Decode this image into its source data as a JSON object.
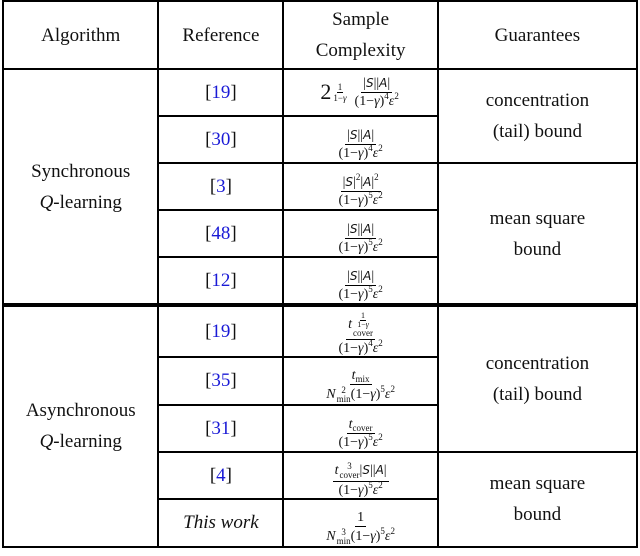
{
  "table": {
    "headers": {
      "algorithm": "Algorithm",
      "reference": "Reference",
      "complexity_line1": "Sample",
      "complexity_line2": "Complexity",
      "guarantees": "Guarantees"
    },
    "groups": [
      {
        "algorithm_line1": "Synchronous",
        "algorithm_q": "Q",
        "algorithm_line2_rest": "-learning",
        "rows": [
          {
            "reference": "19",
            "complexity": "2^{1/(1-γ)} |S||A| / ((1-γ)^4 ε^2)"
          },
          {
            "reference": "30",
            "complexity": "|S||A| / ((1-γ)^4 ε^2)"
          },
          {
            "reference": "3",
            "complexity": "|S|^2 |A|^2 / ((1-γ)^5 ε^2)"
          },
          {
            "reference": "48",
            "complexity": "|S||A| / ((1-γ)^5 ε^2)"
          },
          {
            "reference": "12",
            "complexity": "|S||A| / ((1-γ)^5 ε^2)"
          }
        ],
        "guarantees": [
          {
            "line1": "concentration",
            "line2": "(tail) bound",
            "rows_spanned": 2
          },
          {
            "line1": "mean square",
            "line2": "bound",
            "rows_spanned": 3
          }
        ]
      },
      {
        "algorithm_line1": "Asynchronous",
        "algorithm_q": "Q",
        "algorithm_line2_rest": "-learning",
        "rows": [
          {
            "reference": "19",
            "complexity": "t_cover^{1/(1-γ)} / ((1-γ)^4 ε^2)"
          },
          {
            "reference": "35",
            "complexity": "t_mix / (N_min^2 (1-γ)^5 ε^2)"
          },
          {
            "reference": "31",
            "complexity": "t_cover / ((1-γ)^5 ε^2)"
          },
          {
            "reference": "4",
            "complexity": "t_cover^3 |S||A| / ((1-γ)^5 ε^2)"
          },
          {
            "reference": "This work",
            "complexity": "1 / (N_min^3 (1-γ)^5 ε^2)",
            "italic": true
          }
        ],
        "guarantees": [
          {
            "line1": "concentration",
            "line2": "(tail) bound",
            "rows_spanned": 3
          },
          {
            "line1": "mean square",
            "line2": "bound",
            "rows_spanned": 2
          }
        ]
      }
    ],
    "math_tokens": {
      "S": "S",
      "A": "A",
      "gamma": "γ",
      "eps": "ε",
      "one": "1",
      "two": "2",
      "three": "3",
      "four": "4",
      "five": "5",
      "minus": "−",
      "cover": "cover",
      "mix": "mix",
      "min": "min",
      "t": "t",
      "N": "N"
    },
    "colors": {
      "citation": "#1a1ad6",
      "text": "#111111",
      "rule": "#000000"
    }
  }
}
